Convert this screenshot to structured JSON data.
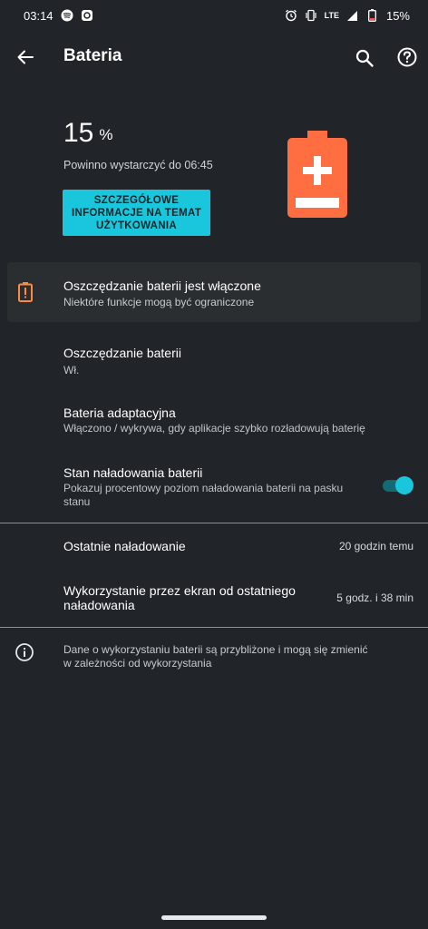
{
  "status_bar": {
    "time": "03:14",
    "network": "LTE",
    "battery_percent": "15%",
    "icons": [
      "spotify-icon",
      "app-notification-icon",
      "alarm-icon",
      "vibrate-icon",
      "lte-icon",
      "signal-icon",
      "battery-low-icon"
    ]
  },
  "app_bar": {
    "title": "Bateria",
    "icons": [
      "back-arrow-icon",
      "search-icon",
      "help-icon"
    ]
  },
  "hero": {
    "percent_value": "15",
    "percent_unit": "%",
    "estimate": "Powinno wystarczyć do 06:45",
    "details_button": "SZCZEGÓŁOWE INFORMACJE NA TEMAT UŻYTKOWANIA",
    "battery_level_fraction": 0.15,
    "battery_color": "#FF6E40"
  },
  "saver_banner": {
    "title": "Oszczędzanie baterii jest włączone",
    "subtitle": "Niektóre funkcje mogą być ograniczone",
    "icon": "battery-alert-icon",
    "icon_color": "#FF8A3D"
  },
  "settings": [
    {
      "title": "Oszczędzanie baterii",
      "subtitle": "Wł."
    },
    {
      "title": "Bateria adaptacyjna",
      "subtitle": "Włączono / wykrywa, gdy aplikacje szybko rozładowują baterię"
    },
    {
      "title": "Stan naładowania baterii",
      "subtitle": "Pokazuj procentowy poziom naładowania baterii na pasku stanu",
      "toggle_on": true
    }
  ],
  "stats": [
    {
      "label": "Ostatnie naładowanie",
      "value": "20 godzin temu"
    },
    {
      "label": "Wykorzystanie przez ekran od ostatniego naładowania",
      "value": "5 godz. i 38 min"
    }
  ],
  "info_note": {
    "text": "Dane o wykorzystaniu baterii są przybliżone i mogą się zmienić w zależności od wykorzystania",
    "icon": "info-icon"
  },
  "colors": {
    "background": "#212529",
    "accent": "#1AC6DB",
    "warning": "#FF6E40"
  }
}
